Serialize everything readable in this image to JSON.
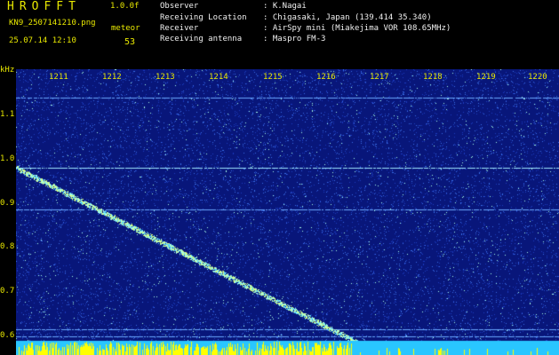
{
  "header": {
    "app_title": "HROFFT",
    "version": "1.0.0f",
    "filename": "KN9_2507141210.png",
    "datetime": "25.07.14 12:10",
    "mode": "meteor",
    "count": "53",
    "info": [
      {
        "label": "Observer",
        "value": ": K.Nagai"
      },
      {
        "label": "Receiving Location",
        "value": ": Chigasaki, Japan (139.414 35.340)"
      },
      {
        "label": "Receiver",
        "value": ": AirSpy mini (Miakejima VOR 108.65MHz)"
      },
      {
        "label": "Receiving antenna",
        "value": ": Maspro FM-3"
      }
    ]
  },
  "chart_data": {
    "type": "heatmap",
    "ylabel": "kHz",
    "x_ticks": [
      "1211",
      "1212",
      "1213",
      "1214",
      "1215",
      "1216",
      "1217",
      "1218",
      "1219",
      "1220"
    ],
    "y_ticks": [
      "1.1",
      "1.0",
      "0.9",
      "0.8",
      "0.7",
      "0.6"
    ],
    "y_range": [
      0.59,
      1.17
    ],
    "horizontal_lines_khz": [
      1.11,
      0.96,
      0.87,
      0.615,
      0.6
    ],
    "meteor_trace": {
      "start": {
        "time": "1210",
        "khz": 0.96
      },
      "end": {
        "time": "1216.4",
        "khz": 0.585
      }
    },
    "colors": {
      "background": "#08167a",
      "noise": "#3a6ee8",
      "bright": "#a8ffe8",
      "trace": "#d8ff80",
      "bottom_bar": "#29c6ff",
      "bottom_bar_spikes": "#ffff00",
      "label": "#e8e800"
    }
  }
}
